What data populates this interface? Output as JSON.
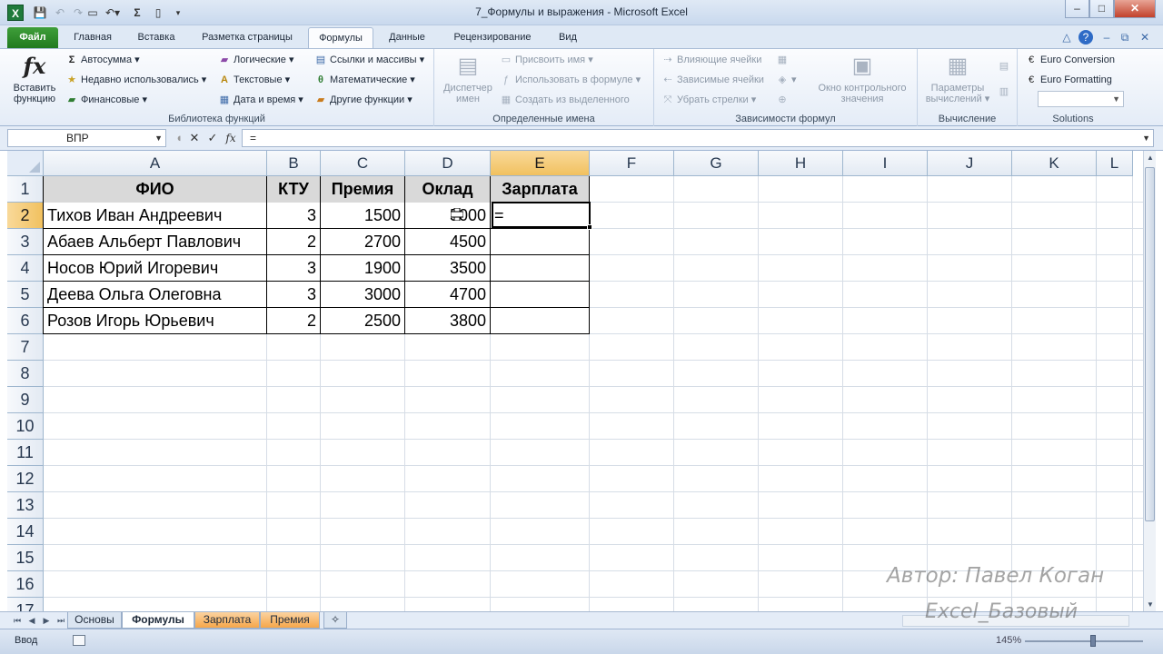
{
  "window": {
    "title": "7_Формулы и выражения - Microsoft Excel",
    "app_icon": "X",
    "quick_access": [
      "save-icon",
      "undo-icon",
      "redo-icon",
      "print-preview-icon",
      "undo-dropdown-icon",
      "autosum-icon",
      "new-document-icon",
      "customize-qat-icon"
    ],
    "controls": {
      "minimize": "–",
      "maximize": "□",
      "close": "✕"
    },
    "inner_controls": {
      "minimize": "–",
      "restore": "⧉",
      "close": "✕"
    }
  },
  "ribbon_tabs": {
    "file": "Файл",
    "home": "Главная",
    "insert": "Вставка",
    "page_layout": "Разметка страницы",
    "formulas": "Формулы",
    "data": "Данные",
    "review": "Рецензирование",
    "view": "Вид",
    "active": "Формулы"
  },
  "ribbon": {
    "function_library": {
      "insert_function": "Вставить функцию",
      "insert_function_icon": "fx",
      "autosum": "Автосумма",
      "recent": "Недавно использовались",
      "financial": "Финансовые",
      "logical": "Логические",
      "text": "Текстовые",
      "datetime": "Дата и время",
      "lookup": "Ссылки и массивы",
      "math": "Математические",
      "other": "Другие функции",
      "label": "Библиотека функций"
    },
    "defined_names": {
      "name_manager": "Диспетчер имен",
      "define_name": "Присвоить имя",
      "use_in_formula": "Использовать в формуле",
      "create_from_selection": "Создать из выделенного",
      "label": "Определенные имена"
    },
    "formula_auditing": {
      "trace_precedents": "Влияющие ячейки",
      "trace_dependents": "Зависимые ячейки",
      "remove_arrows": "Убрать стрелки",
      "watch_window": "Окно контрольного значения",
      "label": "Зависимости формул"
    },
    "calculation": {
      "options": "Параметры вычислений",
      "label": "Вычисление"
    },
    "solutions": {
      "euro_conversion": "Euro Conversion",
      "euro_formatting": "Euro Formatting",
      "label": "Solutions"
    }
  },
  "formula_bar": {
    "name_box": "ВПР",
    "cancel": "✕",
    "enter": "✓",
    "fx": "fx",
    "formula": "="
  },
  "grid": {
    "columns": [
      "A",
      "B",
      "C",
      "D",
      "E",
      "F",
      "G",
      "H",
      "I",
      "J",
      "K",
      "L"
    ],
    "rows": [
      "1",
      "2",
      "3",
      "4",
      "5",
      "6",
      "7",
      "8",
      "9",
      "10",
      "11",
      "12",
      "13",
      "14",
      "15",
      "16",
      "17"
    ],
    "selected_column": "E",
    "selected_row": "2",
    "table": {
      "headers": [
        "ФИО",
        "КТУ",
        "Премия",
        "Оклад",
        "Зарплата"
      ],
      "rows": [
        [
          "Тихов Иван Андреевич",
          "3",
          "1500",
          "5000",
          "="
        ],
        [
          "Абаев Альберт Павлович",
          "2",
          "2700",
          "4500",
          ""
        ],
        [
          "Носов Юрий Игоревич",
          "3",
          "1900",
          "3500",
          ""
        ],
        [
          "Деева  Ольга Олеговна",
          "3",
          "3000",
          "4700",
          ""
        ],
        [
          "Розов Игорь Юрьевич",
          "2",
          "2500",
          "3800",
          ""
        ]
      ]
    }
  },
  "sheets": {
    "tabs": [
      "Основы",
      "Формулы",
      "Зарплата",
      "Премия"
    ],
    "active": "Формулы",
    "tab_colors": {
      "Зарплата": "#f6a64a",
      "Премия": "#f6a64a"
    }
  },
  "statusbar": {
    "mode": "Ввод",
    "zoom": "145%"
  },
  "watermark": {
    "author": "Автор: Павел Коган",
    "course": "Excel_Базовый"
  }
}
